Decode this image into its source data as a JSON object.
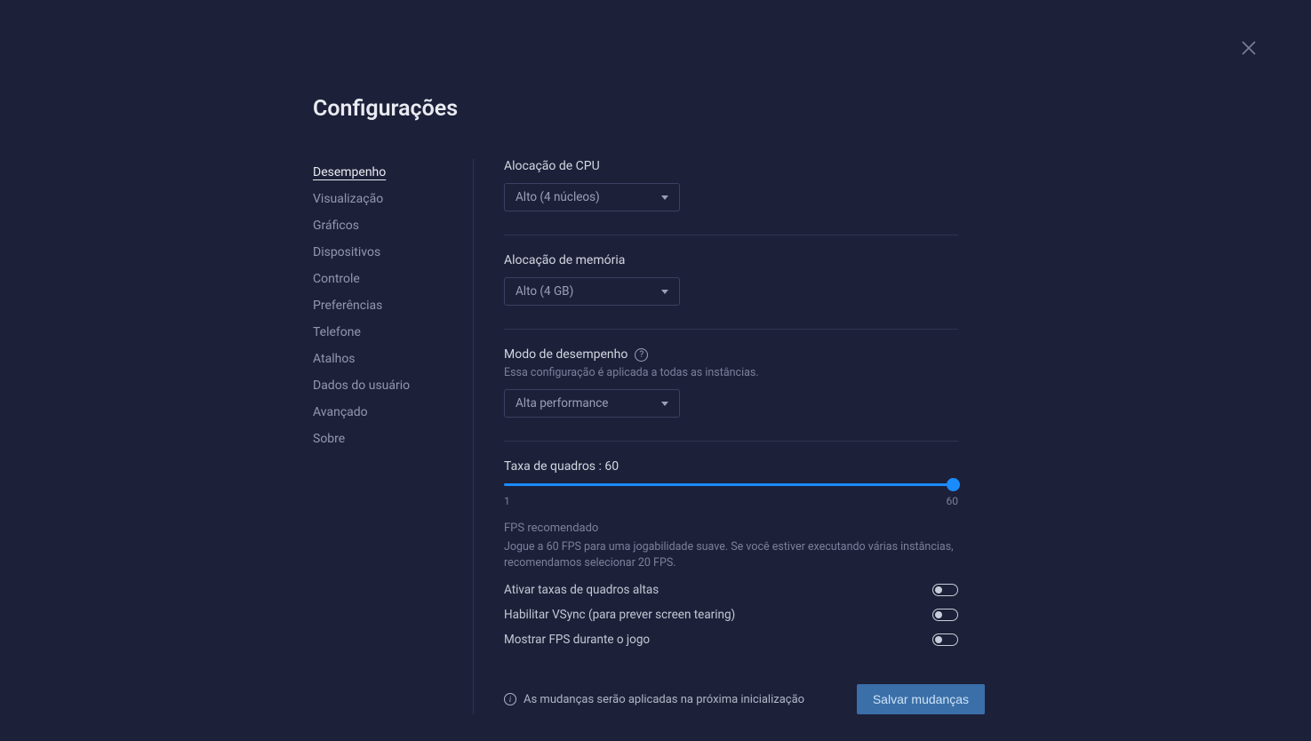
{
  "title": "Configurações",
  "sidebar": {
    "items": [
      {
        "label": "Desempenho",
        "active": true
      },
      {
        "label": "Visualização",
        "active": false
      },
      {
        "label": "Gráficos",
        "active": false
      },
      {
        "label": "Dispositivos",
        "active": false
      },
      {
        "label": "Controle",
        "active": false
      },
      {
        "label": "Preferências",
        "active": false
      },
      {
        "label": "Telefone",
        "active": false
      },
      {
        "label": "Atalhos",
        "active": false
      },
      {
        "label": "Dados do usuário",
        "active": false
      },
      {
        "label": "Avançado",
        "active": false
      },
      {
        "label": "Sobre",
        "active": false
      }
    ]
  },
  "cpu": {
    "label": "Alocação de CPU",
    "value": "Alto (4 núcleos)"
  },
  "memory": {
    "label": "Alocação de memória",
    "value": "Alto (4 GB)"
  },
  "perfmode": {
    "label": "Modo de desempenho",
    "sublabel": "Essa configuração é aplicada a todas as instâncias.",
    "value": "Alta performance"
  },
  "framerate": {
    "label": "Taxa de quadros : 60",
    "min": "1",
    "max": "60",
    "recommended_title": "FPS recomendado",
    "recommended_desc": "Jogue a 60 FPS para uma jogabilidade suave. Se você estiver executando várias instâncias, recomendamos selecionar 20 FPS."
  },
  "toggles": {
    "high_fps": "Ativar taxas de quadros altas",
    "vsync": "Habilitar VSync (para prever screen tearing)",
    "show_fps": "Mostrar FPS durante o jogo"
  },
  "footer": {
    "note": "As mudanças serão aplicadas na próxima inicialização",
    "save": "Salvar mudanças"
  }
}
